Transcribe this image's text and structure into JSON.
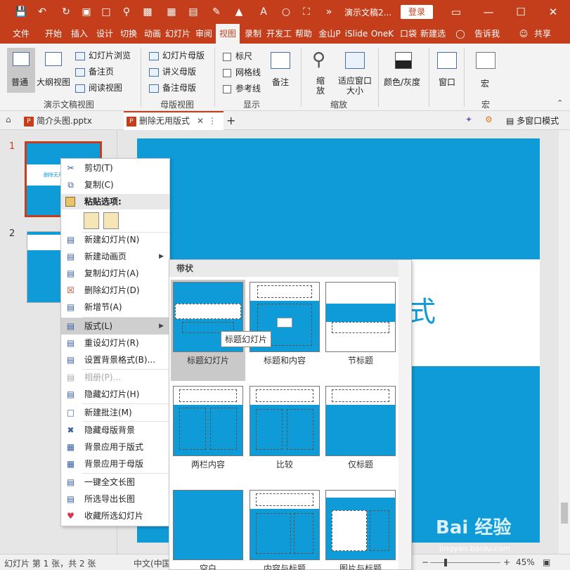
{
  "titlebar": {
    "title": "演示文稿2...",
    "login": "登录",
    "icons": [
      "save-icon",
      "undo-icon",
      "redo-icon",
      "present-icon",
      "new-icon",
      "print-preview-icon",
      "picture-icon",
      "table-icon",
      "arrange-icon",
      "pen-icon",
      "fill-icon",
      "font-color-icon",
      "circle-icon",
      "crop-icon"
    ]
  },
  "tabs": [
    "文件",
    "开始",
    "插入",
    "设计",
    "切换",
    "动画",
    "幻灯片",
    "审阅",
    "视图",
    "录制",
    "开发工",
    "帮助",
    "金山P",
    "iSlide",
    "OneK",
    "口袋",
    "新建选",
    "告诉我",
    "共享"
  ],
  "active_tab": "视图",
  "ribbon": {
    "normal": "普通",
    "outline": "大纲视图",
    "slide_sorter": "幻灯片浏览",
    "notes_page": "备注页",
    "reading_view": "阅读视图",
    "group_presentation_views": "演示文稿视图",
    "slide_master": "幻灯片母版",
    "handout_master": "讲义母版",
    "notes_master": "备注母版",
    "group_master_views": "母版视图",
    "ruler": "标尺",
    "gridlines": "网格线",
    "guides": "参考线",
    "group_show": "显示",
    "notes": "备注",
    "zoom": "缩放",
    "fit_window": "适应窗口大小",
    "group_zoom": "缩放",
    "color_gray": "颜色/灰度",
    "window": "窗口",
    "macro": "宏",
    "group_macro": "宏"
  },
  "doctabs": {
    "tab1": "简介头图.pptx",
    "tab2": "删除无用版式",
    "add": "+",
    "multi_window": "多窗口模式"
  },
  "thumbnails": {
    "slide1_num": "1",
    "slide2_num": "2",
    "slide1_text": "删除无用版式"
  },
  "slide": {
    "title_fragment": "式"
  },
  "context_menu": {
    "items": [
      {
        "label": "剪切(T)",
        "icon": "scissors-icon"
      },
      {
        "label": "复制(C)",
        "icon": "copy-icon"
      },
      {
        "label": "粘贴选项:",
        "icon": "paste-icon"
      },
      {
        "label": "新建幻灯片(N)",
        "icon": "new-slide-icon"
      },
      {
        "label": "新建动画页",
        "icon": "animation-page-icon"
      },
      {
        "label": "复制幻灯片(A)",
        "icon": "duplicate-slide-icon"
      },
      {
        "label": "删除幻灯片(D)",
        "icon": "delete-slide-icon"
      },
      {
        "label": "新增节(A)",
        "icon": "add-section-icon"
      },
      {
        "label": "版式(L)",
        "icon": "layout-icon"
      },
      {
        "label": "重设幻灯片(R)",
        "icon": "reset-slide-icon"
      },
      {
        "label": "设置背景格式(B)...",
        "icon": "background-icon"
      },
      {
        "label": "相册(P)...",
        "icon": "photo-album-icon"
      },
      {
        "label": "隐藏幻灯片(H)",
        "icon": "hide-slide-icon"
      },
      {
        "label": "新建批注(M)",
        "icon": "comment-icon"
      },
      {
        "label": "隐藏母版背景",
        "icon": "hide-master-bg-icon"
      },
      {
        "label": "背景应用于版式",
        "icon": "apply-layout-icon"
      },
      {
        "label": "背景应用于母版",
        "icon": "apply-master-icon"
      },
      {
        "label": "一键全文长图",
        "icon": "long-image-icon"
      },
      {
        "label": "所选导出长图",
        "icon": "export-image-icon"
      },
      {
        "label": "收藏所选幻灯片",
        "icon": "favorite-icon"
      }
    ]
  },
  "layout_gallery": {
    "heading": "带状",
    "items": [
      "标题幻灯片",
      "标题和内容",
      "节标题",
      "两栏内容",
      "比较",
      "仅标题",
      "空白",
      "内容与标题",
      "图片与标题"
    ],
    "tooltip": "标题幻灯片"
  },
  "statusbar": {
    "slide_info": "幻灯片 第 1 张，共 2 张",
    "language": "中文(中国",
    "zoom": "45%"
  },
  "watermark": {
    "brand": "Bai 经验",
    "url": "jingyan.baidu.com"
  },
  "colors": {
    "accent": "#c43e1c",
    "slide_blue": "#0f9bd7"
  }
}
